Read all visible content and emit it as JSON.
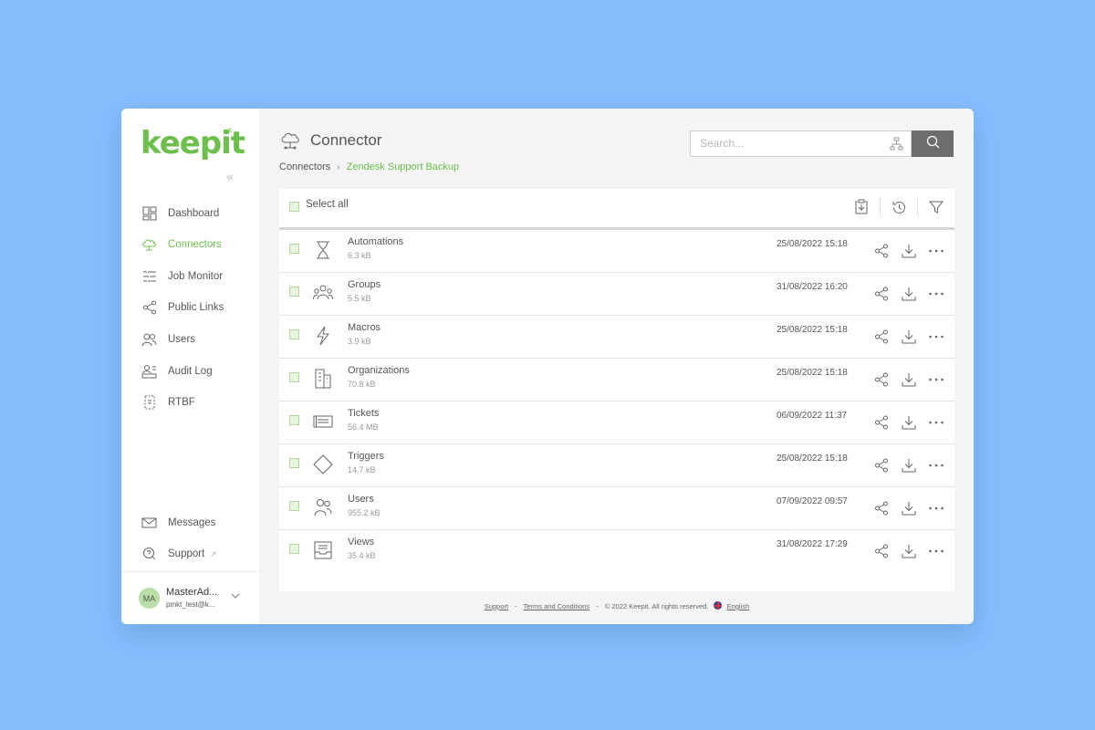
{
  "brand": {
    "logo_text": "keepit",
    "reg_mark": "®",
    "accent_color": "#6cbf4b"
  },
  "sidebar": {
    "collapse_glyph": "«",
    "items": [
      {
        "label": "Dashboard",
        "icon": "dashboard-icon",
        "active": false
      },
      {
        "label": "Connectors",
        "icon": "cloud-icon",
        "active": true
      },
      {
        "label": "Job Monitor",
        "icon": "job-monitor-icon",
        "active": false
      },
      {
        "label": "Public Links",
        "icon": "share-icon",
        "active": false
      },
      {
        "label": "Users",
        "icon": "users-icon",
        "active": false
      },
      {
        "label": "Audit Log",
        "icon": "audit-log-icon",
        "active": false
      },
      {
        "label": "RTBF",
        "icon": "rtbf-icon",
        "active": false
      }
    ],
    "bottom_items": [
      {
        "label": "Messages",
        "icon": "mail-icon"
      },
      {
        "label": "Support",
        "icon": "support-icon"
      }
    ],
    "user": {
      "initials": "MA",
      "name": "MasterAd...",
      "email": "pmkt_test@k..."
    }
  },
  "header": {
    "title": "Connector",
    "breadcrumb": {
      "root": "Connectors",
      "current": "Zendesk Support Backup"
    },
    "search": {
      "placeholder": "Search..."
    }
  },
  "toolbar": {
    "select_all_label": "Select all"
  },
  "items": [
    {
      "name": "Automations",
      "size": "6.3 kB",
      "date": "25/08/2022 15:18",
      "icon": "hourglass-icon"
    },
    {
      "name": "Groups",
      "size": "5.5 kB",
      "date": "31/08/2022 16:20",
      "icon": "group-icon"
    },
    {
      "name": "Macros",
      "size": "3.9 kB",
      "date": "25/08/2022 15:18",
      "icon": "lightning-icon"
    },
    {
      "name": "Organizations",
      "size": "70.8 kB",
      "date": "25/08/2022 15:18",
      "icon": "building-icon"
    },
    {
      "name": "Tickets",
      "size": "56.4 MB",
      "date": "06/09/2022 11:37",
      "icon": "ticket-icon"
    },
    {
      "name": "Triggers",
      "size": "14.7 kB",
      "date": "25/08/2022 15:18",
      "icon": "diamond-icon"
    },
    {
      "name": "Users",
      "size": "955.2 kB",
      "date": "07/09/2022 09:57",
      "icon": "users-icon"
    },
    {
      "name": "Views",
      "size": "35.4 kB",
      "date": "31/08/2022 17:29",
      "icon": "inbox-icon"
    }
  ],
  "footer": {
    "support": "Support",
    "terms": "Terms and Conditions",
    "copyright": "© 2022 Keepit. All rights reserved.",
    "language": "English",
    "separator": "-"
  }
}
